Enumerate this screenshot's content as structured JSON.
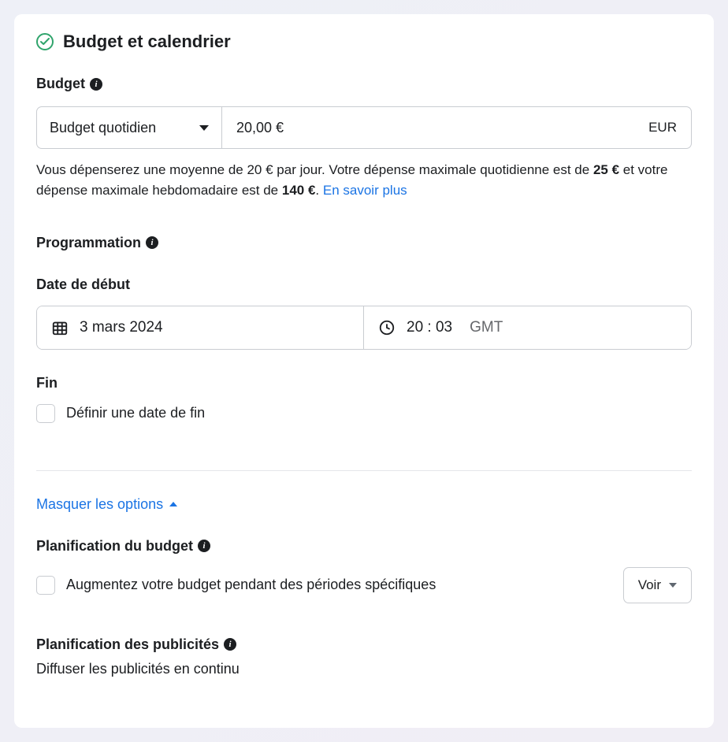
{
  "header": {
    "title": "Budget et calendrier"
  },
  "budget": {
    "label": "Budget",
    "select_value": "Budget quotidien",
    "amount": "20,00 €",
    "currency": "EUR",
    "helper_prefix": "Vous dépenserez une moyenne de 20 € par jour. Votre dépense maximale quotidienne est de ",
    "daily_max": "25 €",
    "helper_mid": " et votre dépense maximale hebdomadaire est de ",
    "weekly_max": "140 €",
    "helper_suffix": ". ",
    "learn_more": "En savoir plus"
  },
  "schedule": {
    "label": "Programmation",
    "start_label": "Date de début",
    "start_date": "3 mars 2024",
    "start_time": "20 : 03",
    "timezone": "GMT",
    "end_label": "Fin",
    "end_checkbox_label": "Définir une date de fin"
  },
  "options_toggle": "Masquer les options",
  "budget_plan": {
    "label": "Planification du budget",
    "checkbox_label": "Augmentez votre budget pendant des périodes spécifiques",
    "view_button": "Voir"
  },
  "ad_plan": {
    "label": "Planification des publicités",
    "body": "Diffuser les publicités en continu"
  }
}
